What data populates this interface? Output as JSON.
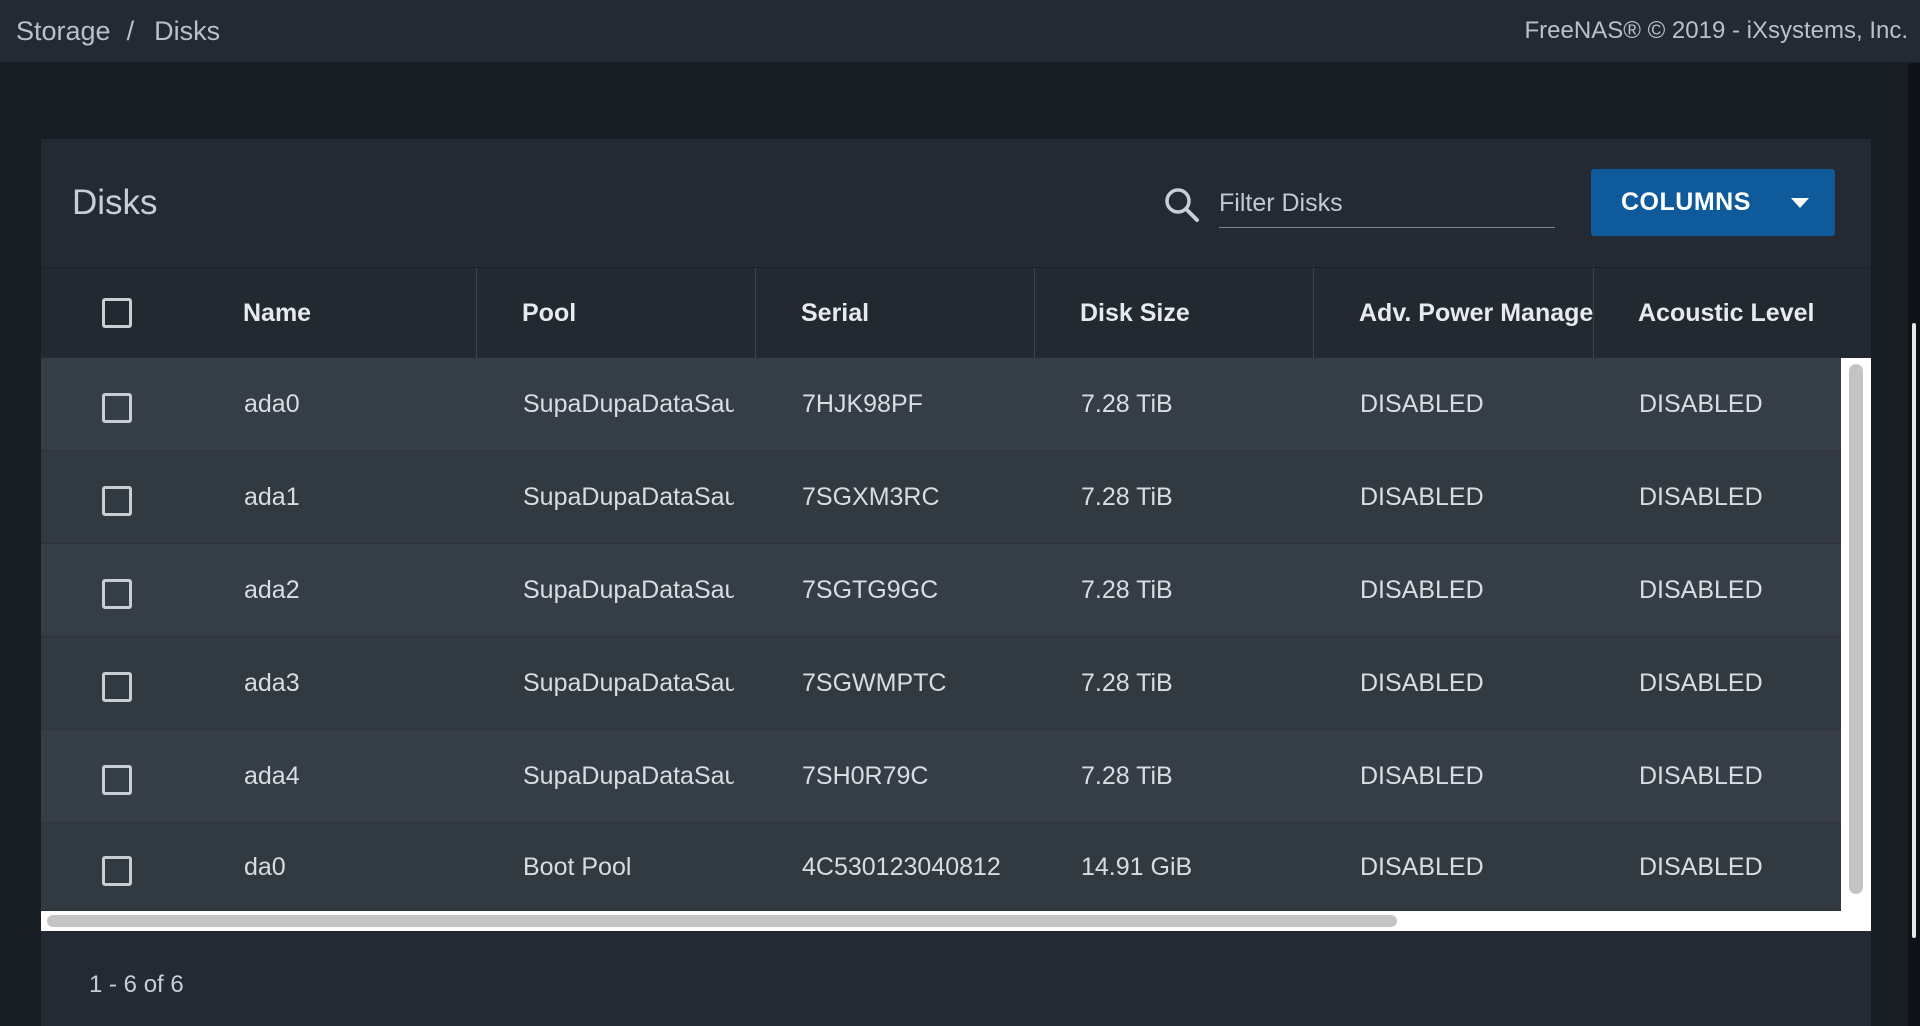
{
  "breadcrumb": {
    "parent": "Storage",
    "separator": "/",
    "current": "Disks"
  },
  "copyright": "FreeNAS® © 2019 - iXsystems, Inc.",
  "card": {
    "title": "Disks",
    "filter_placeholder": "Filter Disks",
    "columns_button": "COLUMNS"
  },
  "table": {
    "headers": [
      "Name",
      "Pool",
      "Serial",
      "Disk Size",
      "Adv. Power Management",
      "Acoustic Level"
    ],
    "rows": [
      {
        "name": "ada0",
        "pool": "SupaDupaDataSauce",
        "serial": "7HJK98PF",
        "size": "7.28 TiB",
        "apm": "DISABLED",
        "acoustic": "DISABLED"
      },
      {
        "name": "ada1",
        "pool": "SupaDupaDataSauce",
        "serial": "7SGXM3RC",
        "size": "7.28 TiB",
        "apm": "DISABLED",
        "acoustic": "DISABLED"
      },
      {
        "name": "ada2",
        "pool": "SupaDupaDataSauce",
        "serial": "7SGTG9GC",
        "size": "7.28 TiB",
        "apm": "DISABLED",
        "acoustic": "DISABLED"
      },
      {
        "name": "ada3",
        "pool": "SupaDupaDataSauce",
        "serial": "7SGWMPTC",
        "size": "7.28 TiB",
        "apm": "DISABLED",
        "acoustic": "DISABLED"
      },
      {
        "name": "ada4",
        "pool": "SupaDupaDataSauce",
        "serial": "7SH0R79C",
        "size": "7.28 TiB",
        "apm": "DISABLED",
        "acoustic": "DISABLED"
      },
      {
        "name": "da0",
        "pool": "Boot Pool",
        "serial": "4C530123040812",
        "size": "14.91 GiB",
        "apm": "DISABLED",
        "acoustic": "DISABLED"
      }
    ]
  },
  "pagination": "1 - 6 of 6",
  "icons": {
    "search": "search-icon",
    "dropdown": "caret-down-icon"
  },
  "colors": {
    "accent": "#0f5a9a",
    "topbar": "#232a33",
    "row": "#353d46"
  }
}
